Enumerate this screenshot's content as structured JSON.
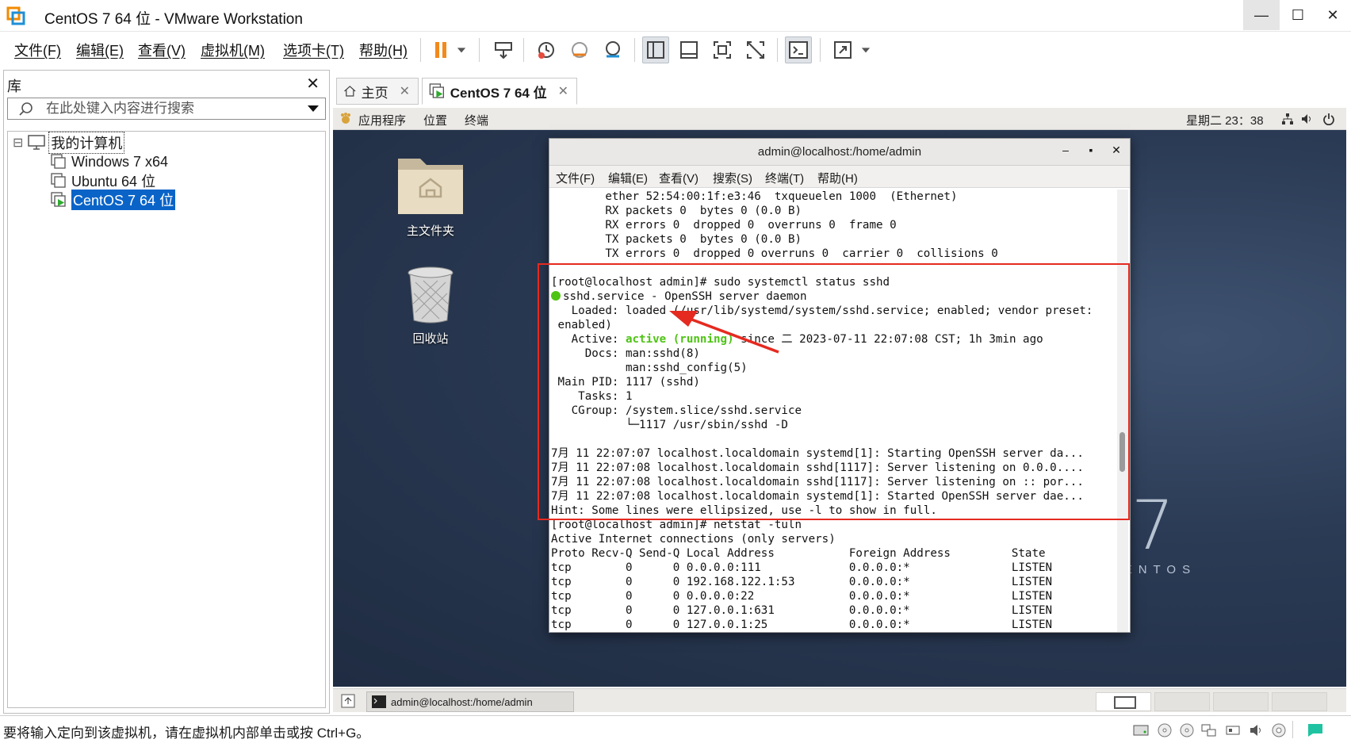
{
  "window": {
    "title": "CentOS 7 64 位 - VMware Workstation",
    "minimize": "—",
    "maximize": "☐",
    "close": "✕"
  },
  "menu": {
    "file": "文件(F)",
    "edit": "编辑(E)",
    "view": "查看(V)",
    "vm": "虚拟机(M)",
    "tabs": "选项卡(T)",
    "help": "帮助(H)"
  },
  "toolbar_icons": [
    "pause-icon",
    "dropdown-icon",
    "send-ctrl-alt-del-icon",
    "snapshot-icon",
    "revert-snapshot-icon",
    "snapshot-manager-icon",
    "library-view-icon",
    "console-view-icon",
    "fullscreen-icon",
    "unity-icon",
    "terminal-icon",
    "stretch-icon"
  ],
  "library": {
    "title": "库",
    "close": "✕",
    "search_placeholder": "在此处键入内容进行搜索",
    "tree": {
      "collapse": "⊟",
      "root": "我的计算机",
      "items": [
        "Windows 7 x64",
        "Ubuntu 64 位",
        "CentOS 7 64 位"
      ],
      "selected_index": 2
    }
  },
  "tabs": [
    {
      "label": "主页",
      "close": "✕"
    },
    {
      "label": "CentOS 7 64 位",
      "close": "✕"
    }
  ],
  "gnome": {
    "apps": "应用程序",
    "places": "位置",
    "terminal": "终端",
    "clock": "星期二 23：38"
  },
  "desktop": {
    "home_folder": "主文件夹",
    "trash": "回收站"
  },
  "terminal": {
    "title": "admin@localhost:/home/admin",
    "btn_min": "–",
    "btn_max": "▪",
    "btn_close": "✕",
    "menu": [
      "文件(F)",
      "编辑(E)",
      "查看(V)",
      "搜索(S)",
      "终端(T)",
      "帮助(H)"
    ],
    "lines": [
      "        ether 52:54:00:1f:e3:46  txqueuelen 1000  (Ethernet)",
      "        RX packets 0  bytes 0 (0.0 B)",
      "        RX errors 0  dropped 0  overruns 0  frame 0",
      "        TX packets 0  bytes 0 (0.0 B)",
      "        TX errors 0  dropped 0 overruns 0  carrier 0  collisions 0",
      "",
      "[root@localhost admin]# sudo systemctl status sshd",
      "sshd.service - OpenSSH server daemon",
      "   Loaded: loaded (/usr/lib/systemd/system/sshd.service; enabled; vendor preset:",
      " enabled)",
      "   Active: ",
      "     Docs: man:sshd(8)",
      "           man:sshd_config(5)",
      " Main PID: 1117 (sshd)",
      "    Tasks: 1",
      "   CGroup: /system.slice/sshd.service",
      "           └─1117 /usr/sbin/sshd -D",
      "",
      "7月 11 22:07:07 localhost.localdomain systemd[1]: Starting OpenSSH server da...",
      "7月 11 22:07:08 localhost.localdomain sshd[1117]: Server listening on 0.0.0....",
      "7月 11 22:07:08 localhost.localdomain sshd[1117]: Server listening on :: por...",
      "7月 11 22:07:08 localhost.localdomain systemd[1]: Started OpenSSH server dae...",
      "Hint: Some lines were ellipsized, use -l to show in full.",
      "[root@localhost admin]# netstat -tuln",
      "Active Internet connections (only servers)",
      "Proto Recv-Q Send-Q Local Address           Foreign Address         State",
      "tcp        0      0 0.0.0.0:111             0.0.0.0:*               LISTEN",
      "tcp        0      0 192.168.122.1:53        0.0.0.0:*               LISTEN",
      "tcp        0      0 0.0.0.0:22              0.0.0.0:*               LISTEN",
      "tcp        0      0 127.0.0.1:631           0.0.0.0:*               LISTEN",
      "tcp        0      0 127.0.0.1:25            0.0.0.0:*               LISTEN"
    ],
    "active_status": "active (running)",
    "active_since": " since 二 2023-07-11 22:07:08 CST; 1h 3min ago",
    "annotation_color": "#e52a20",
    "status_color": "#4ec415"
  },
  "centos_logo": {
    "number": "7",
    "word": "CENTOS"
  },
  "taskbar": {
    "item": "admin@localhost:/home/admin"
  },
  "statusbar": {
    "text": "要将输入定向到该虚拟机，请在虚拟机内部单击或按 Ctrl+G。"
  }
}
